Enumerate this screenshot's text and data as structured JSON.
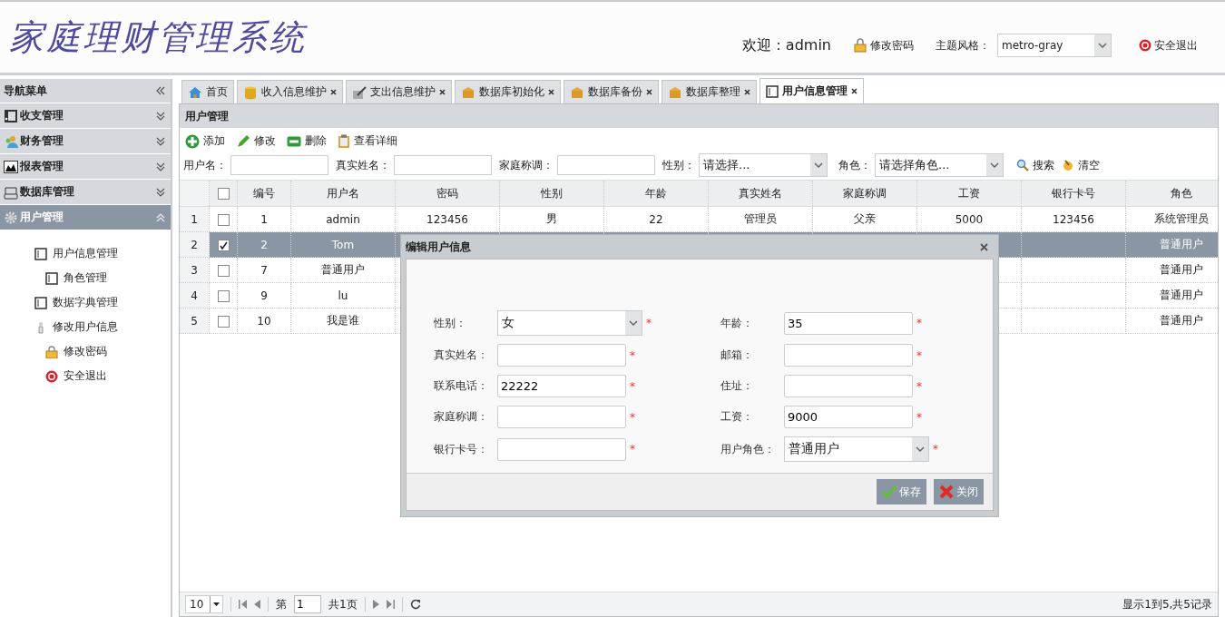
{
  "header": {
    "title": "家庭理财管理系统",
    "welcome_label": "欢迎：",
    "user": "admin",
    "change_password": "修改密码",
    "theme_label": "主题风格：",
    "theme": "metro-gray",
    "logout": "安全退出"
  },
  "sidebar": {
    "title": "导航菜单",
    "sections": [
      {
        "label": "收支管理",
        "expanded": false
      },
      {
        "label": "财务管理",
        "expanded": false
      },
      {
        "label": "报表管理",
        "expanded": false
      },
      {
        "label": "数据库管理",
        "expanded": false
      },
      {
        "label": "用户管理",
        "expanded": true,
        "items": [
          {
            "label": "用户信息管理",
            "children": [
              {
                "label": "角色管理"
              }
            ]
          },
          {
            "label": "数据字典管理"
          },
          {
            "label": "修改用户信息",
            "children": [
              {
                "label": "修改密码"
              },
              {
                "label": "安全退出"
              }
            ]
          }
        ]
      }
    ]
  },
  "tabs": [
    {
      "label": "首页",
      "closable": false,
      "selected": false
    },
    {
      "label": "收入信息维护",
      "closable": true,
      "selected": false
    },
    {
      "label": "支出信息维护",
      "closable": true,
      "selected": false
    },
    {
      "label": "数据库初始化",
      "closable": true,
      "selected": false
    },
    {
      "label": "数据库备份",
      "closable": true,
      "selected": false
    },
    {
      "label": "数据库整理",
      "closable": true,
      "selected": false
    },
    {
      "label": "用户信息管理",
      "closable": true,
      "selected": true
    }
  ],
  "panel": {
    "title": "用户管理",
    "toolbar": [
      "添加",
      "修改",
      "删除",
      "查看详细"
    ],
    "filters": [
      {
        "label": "用户名：",
        "kind": "text"
      },
      {
        "label": "真实姓名：",
        "kind": "text"
      },
      {
        "label": "家庭称调：",
        "kind": "text"
      },
      {
        "label": "性别：",
        "kind": "select",
        "value": "请选择..."
      },
      {
        "label": "角色：",
        "kind": "select",
        "value": "请选择角色..."
      }
    ],
    "search": "搜索",
    "clear": "清空",
    "table": {
      "all_checked": false,
      "columns": [
        "编号",
        "用户名",
        "密码",
        "性别",
        "年龄",
        "真实姓名",
        "家庭称调",
        "工资",
        "银行卡号",
        "角色"
      ],
      "rows": [
        {
          "index": "1",
          "checked": false,
          "selected": false,
          "cells": [
            "1",
            "admin",
            "123456",
            "男",
            "22",
            "管理员",
            "父亲",
            "5000",
            "123456",
            "系统管理员"
          ]
        },
        {
          "index": "2",
          "checked": true,
          "selected": true,
          "cells": [
            "2",
            "Tom",
            null,
            null,
            null,
            null,
            null,
            null,
            null,
            "普通用户"
          ]
        },
        {
          "index": "3",
          "checked": false,
          "selected": false,
          "cells": [
            "7",
            "普通用户",
            null,
            null,
            null,
            null,
            null,
            null,
            null,
            "普通用户"
          ]
        },
        {
          "index": "4",
          "checked": false,
          "selected": false,
          "cells": [
            "9",
            "lu",
            null,
            null,
            null,
            null,
            null,
            null,
            null,
            "普通用户"
          ]
        },
        {
          "index": "5",
          "checked": false,
          "selected": false,
          "cells": [
            "10",
            "我是谁",
            null,
            null,
            null,
            null,
            null,
            null,
            null,
            "普通用户"
          ]
        }
      ]
    },
    "pager": {
      "page_size": "10",
      "before": "第",
      "page": "1",
      "after": "共1页",
      "summary": "显示1到5,共5记录"
    }
  },
  "dialog": {
    "title": "编辑用户信息",
    "fields": [
      {
        "label": "性别：",
        "kind": "select",
        "value": "女",
        "mark": "*"
      },
      {
        "label": "年龄：",
        "kind": "text",
        "value": "35",
        "mark": "*"
      },
      {
        "label": "真实姓名：",
        "kind": "text",
        "mark": "*"
      },
      {
        "label": "邮箱：",
        "kind": "text",
        "mark": "*"
      },
      {
        "label": "联系电话：",
        "kind": "text",
        "value": "22222",
        "mark": "*"
      },
      {
        "label": "住址：",
        "kind": "text",
        "mark": "*"
      },
      {
        "label": "家庭称调：",
        "kind": "text",
        "mark": "*"
      },
      {
        "label": "工资：",
        "kind": "text",
        "value": "9000",
        "mark": "*"
      },
      {
        "label": "银行卡号：",
        "kind": "text",
        "mark": "*"
      },
      {
        "label": "用户角色：",
        "kind": "select",
        "value": "普通用户",
        "mark": "*"
      }
    ],
    "buttons": [
      "保存",
      "关闭"
    ]
  }
}
